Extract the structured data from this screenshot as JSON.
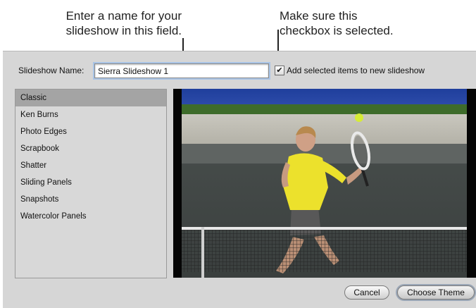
{
  "callouts": {
    "name_field": [
      "Enter a name for your",
      "slideshow in this field."
    ],
    "checkbox": [
      "Make sure this",
      "checkbox is selected."
    ]
  },
  "dialog": {
    "name_label": "Slideshow Name:",
    "name_value": "Sierra Slideshow 1",
    "checkbox_checked": true,
    "checkbox_label": "Add selected items to new slideshow",
    "themes": [
      "Classic",
      "Ken Burns",
      "Photo Edges",
      "Scrapbook",
      "Shatter",
      "Sliding Panels",
      "Snapshots",
      "Watercolor Panels"
    ],
    "selected_theme": "Classic",
    "cancel_label": "Cancel",
    "choose_label": "Choose Theme"
  },
  "colors": {
    "dialog_bg": "#d6d6d6",
    "selected_row": "#a4a4a4",
    "focus_ring": "#a9c4e6"
  }
}
